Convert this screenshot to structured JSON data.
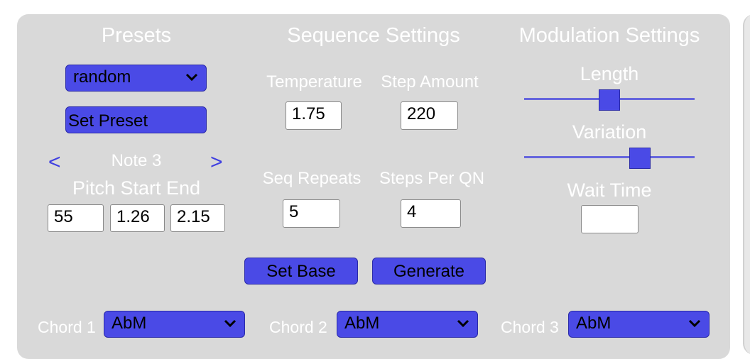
{
  "presets": {
    "heading": "Presets",
    "selected": "random",
    "set_button": "Set Preset",
    "note_prev": "<",
    "note_label": "Note 3",
    "note_next": ">",
    "pitch_header": "Pitch Start End",
    "pitch": "55",
    "start": "1.26",
    "end": "2.15"
  },
  "sequence": {
    "heading": "Sequence Settings",
    "temperature_label": "Temperature",
    "temperature": "1.75",
    "step_amount_label": "Step Amount",
    "step_amount": "220",
    "seq_repeats_label": "Seq Repeats",
    "seq_repeats": "5",
    "steps_per_qn_label": "Steps Per QN",
    "steps_per_qn": "4",
    "set_base_button": "Set Base",
    "generate_button": "Generate"
  },
  "modulation": {
    "heading": "Modulation Settings",
    "length_label": "Length",
    "length_level": 0.5,
    "variation_label": "Variation",
    "variation_level": 0.68,
    "wait_time_label": "Wait Time",
    "wait_time": ""
  },
  "chords": [
    {
      "label": "Chord 1",
      "value": "AbM"
    },
    {
      "label": "Chord 2",
      "value": "AbM"
    },
    {
      "label": "Chord 3",
      "value": "AbM"
    }
  ],
  "colors": {
    "panel_bg": "#d9d9d9",
    "accent": "#4a4ae6",
    "arrow": "#3f3fe0"
  }
}
